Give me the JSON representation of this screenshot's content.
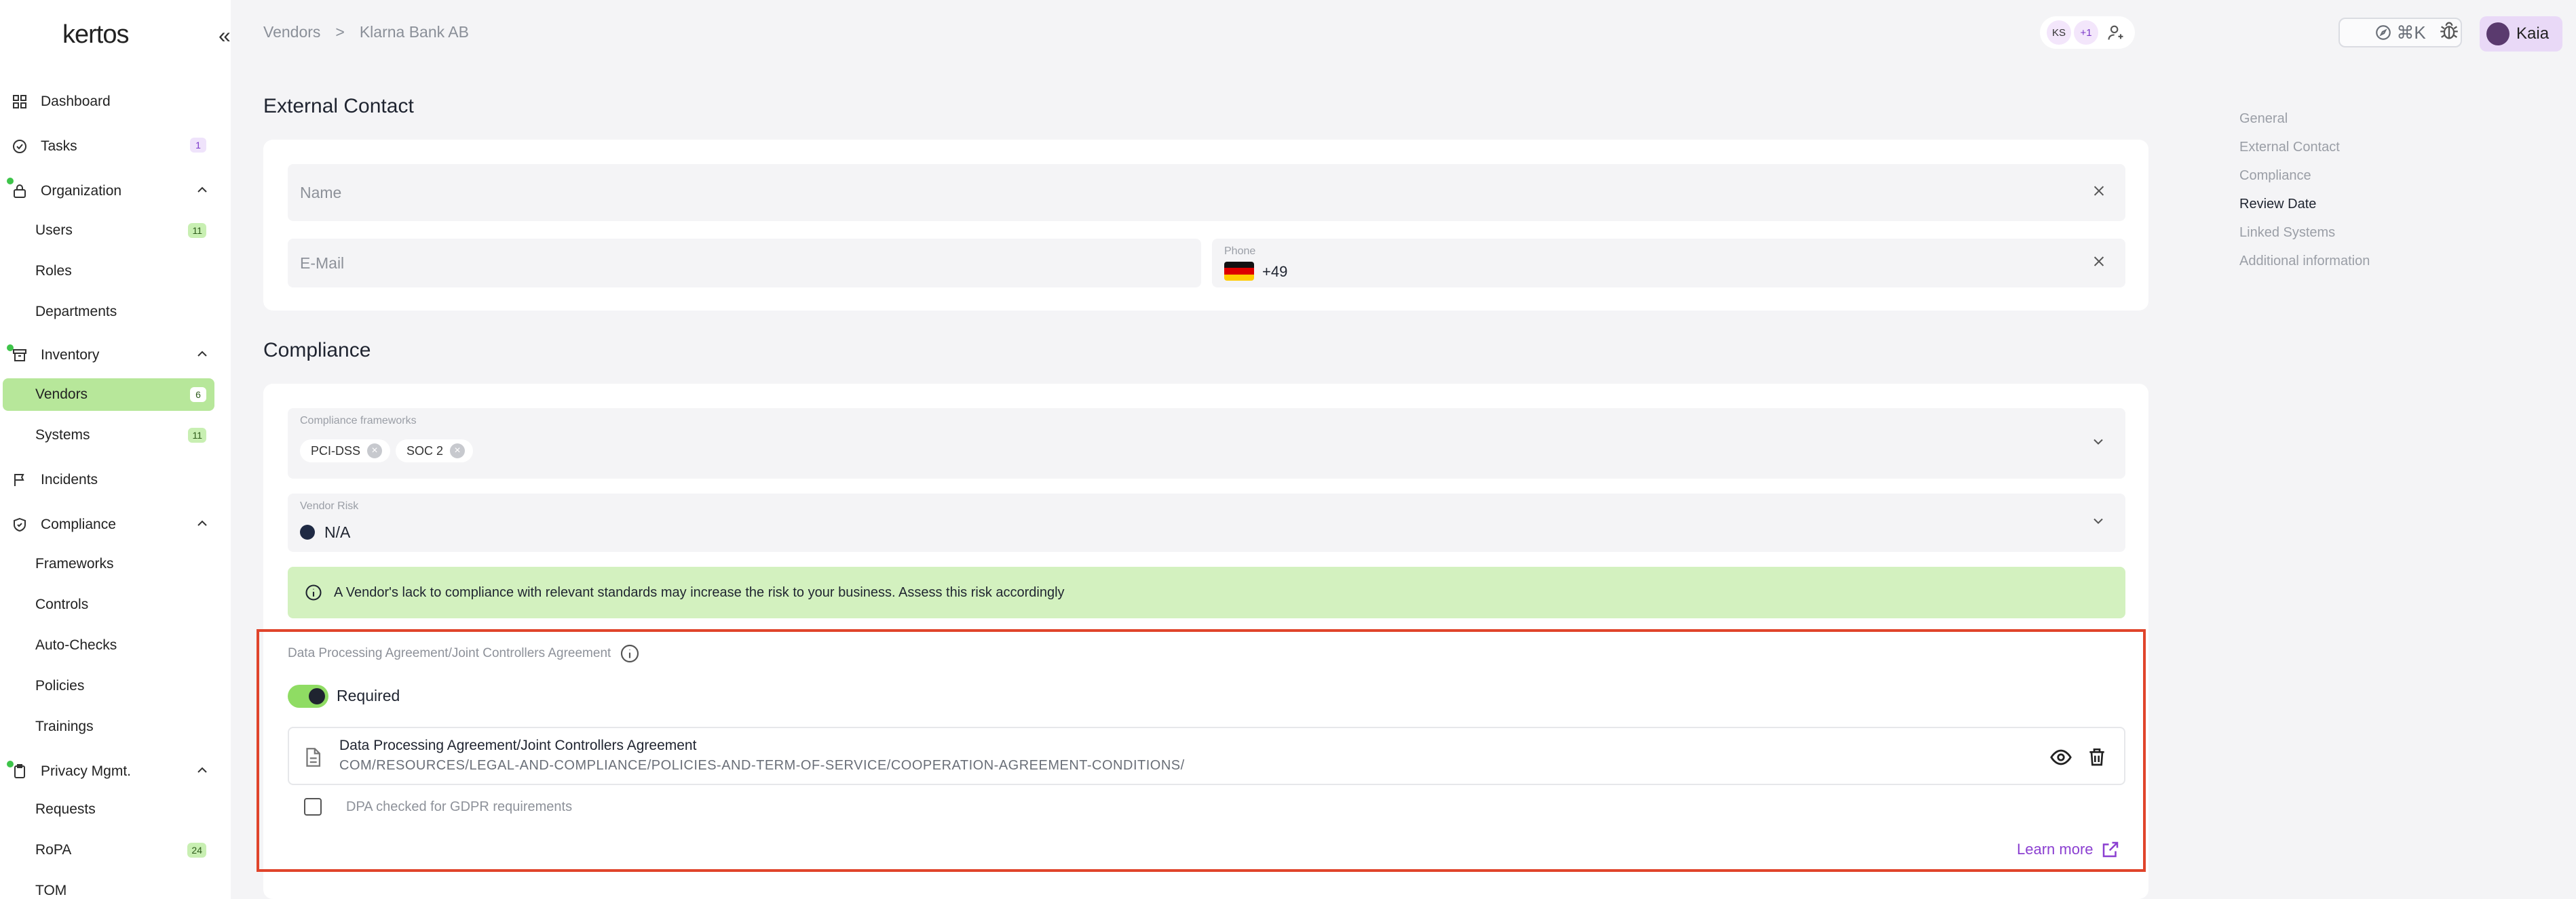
{
  "app": {
    "logo": "kertos"
  },
  "sidebar": {
    "dashboard": "Dashboard",
    "tasks": {
      "label": "Tasks",
      "badge": "1"
    },
    "organization": {
      "label": "Organization",
      "items": [
        {
          "label": "Users",
          "badge": "11"
        },
        {
          "label": "Roles"
        },
        {
          "label": "Departments"
        }
      ]
    },
    "inventory": {
      "label": "Inventory",
      "items": [
        {
          "label": "Vendors",
          "badge": "6"
        },
        {
          "label": "Systems",
          "badge": "11"
        }
      ]
    },
    "incidents": "Incidents",
    "compliance": {
      "label": "Compliance",
      "items": [
        {
          "label": "Frameworks"
        },
        {
          "label": "Controls"
        },
        {
          "label": "Auto-Checks"
        },
        {
          "label": "Policies"
        },
        {
          "label": "Trainings"
        }
      ]
    },
    "privacy": {
      "label": "Privacy Mgmt.",
      "items": [
        {
          "label": "Requests"
        },
        {
          "label": "RoPA",
          "badge": "24"
        },
        {
          "label": "TOM"
        }
      ]
    }
  },
  "breadcrumb": {
    "root": "Vendors",
    "separator": ">",
    "current": "Klarna Bank AB"
  },
  "topbar": {
    "avatar_initials": "KS",
    "avatar_more": "+1",
    "cmdk": "⌘K",
    "user_name": "Kaia"
  },
  "external_contact": {
    "title": "External Contact",
    "name_placeholder": "Name",
    "email_placeholder": "E-Mail",
    "phone_label": "Phone",
    "phone_prefix": "+49"
  },
  "compliance": {
    "title": "Compliance",
    "frameworks_label": "Compliance frameworks",
    "frameworks": [
      "PCI-DSS",
      "SOC 2"
    ],
    "risk_label": "Vendor Risk",
    "risk_value": "N/A",
    "info_text": "A Vendor's lack to compliance with relevant standards may increase the risk to your business. Assess this risk accordingly",
    "dpa_label": "Data Processing Agreement/Joint Controllers Agreement",
    "required_label": "Required",
    "file_title": "Data Processing Agreement/Joint Controllers Agreement",
    "file_path": "COM/RESOURCES/LEGAL-AND-COMPLIANCE/POLICIES-AND-TERM-OF-SERVICE/COOPERATION-AGREEMENT-CONDITIONS/",
    "dpa_check_label": "DPA checked for GDPR requirements",
    "learn_more": "Learn more"
  },
  "toc": [
    "General",
    "External Contact",
    "Compliance",
    "Review Date",
    "Linked Systems",
    "Additional information"
  ],
  "colors": {
    "accent_green": "#b7e79a",
    "highlight_red": "#e0442b",
    "link_purple": "#8b3fd1"
  }
}
